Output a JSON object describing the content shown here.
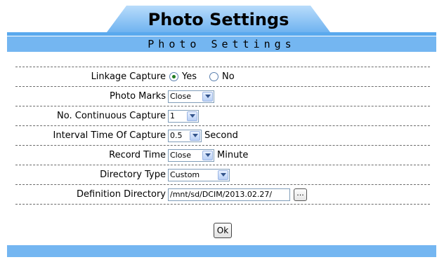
{
  "header": {
    "tab_title": "Photo Settings",
    "section_title": "Photo Settings"
  },
  "form": {
    "linkage_capture": {
      "label": "Linkage Capture",
      "options": [
        "Yes",
        "No"
      ],
      "selected": "Yes"
    },
    "photo_marks": {
      "label": "Photo Marks",
      "value": "Close"
    },
    "continuous_capture": {
      "label": "No. Continuous Capture",
      "value": "1"
    },
    "interval_time": {
      "label": "Interval Time Of Capture",
      "value": "0.5",
      "unit": "Second"
    },
    "record_time": {
      "label": "Record Time",
      "value": "Close",
      "unit": "Minute"
    },
    "directory_type": {
      "label": "Directory Type",
      "value": "Custom"
    },
    "definition_directory": {
      "label": "Definition Directory",
      "value": "/mnt/sd/DCIM/2013.02.27/",
      "browse_label": "..."
    }
  },
  "actions": {
    "ok_label": "Ok"
  },
  "colors": {
    "accent": "#74b6f1",
    "tab_gradient_top": "#b9dcfb",
    "tab_gradient_bottom": "#6fb3f0"
  }
}
